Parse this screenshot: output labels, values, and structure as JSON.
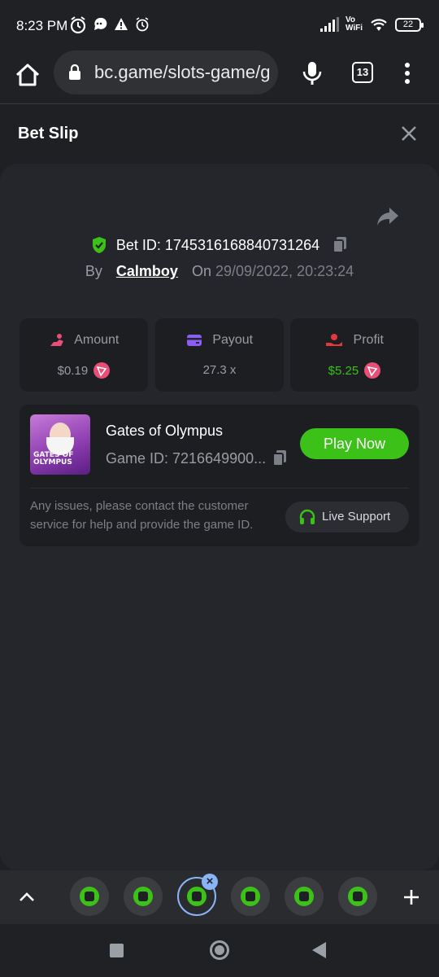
{
  "status_bar": {
    "time": "8:23 PM",
    "network_label": "Vo WiFi",
    "battery": "22"
  },
  "browser": {
    "url": "bc.game/slots-game/g",
    "tab_count": "13"
  },
  "bet_slip": {
    "title": "Bet Slip",
    "bet_id_label": "Bet ID: 1745316168840731264",
    "by_label": "By",
    "user": "Calmboy",
    "on_label": "On",
    "date": "29/09/2022, 20:23:24"
  },
  "stats": {
    "amount_label": "Amount",
    "amount_value": "$0.19",
    "payout_label": "Payout",
    "payout_value": "27.3 x",
    "profit_label": "Profit",
    "profit_value": "$5.25"
  },
  "game": {
    "thumb_text_1": "GATES OF",
    "thumb_text_2": "OLYMPUS",
    "name": "Gates of Olympus",
    "game_id": "Game ID: 7216649900...",
    "play_label": "Play Now",
    "note": "Any issues, please contact the customer service for help and provide the game ID.",
    "support_label": "Live Support"
  },
  "colors": {
    "accent_green": "#3bc117",
    "coin_pink": "#e94e77",
    "bg": "#202124"
  }
}
